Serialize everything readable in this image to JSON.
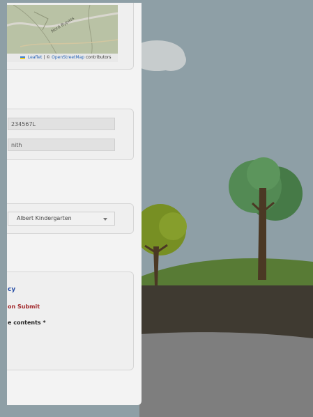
{
  "map": {
    "road_label": "Nord Bypass",
    "attribution": {
      "leaflet": "Leaflet",
      "separator": "| ©",
      "osm": "OpenStreetMap",
      "contributors": "contributors"
    }
  },
  "form": {
    "id_value": "234567L",
    "name_value": "nith",
    "school_select": "Albert Kindergarten",
    "policy_link": "cy",
    "submit_warning": "on Submit",
    "contents_label": "e contents *"
  },
  "colors": {
    "overlay": "#8e9fa6",
    "panel": "#f3f3f3",
    "link": "#274ea5",
    "warning": "#a1272a"
  }
}
